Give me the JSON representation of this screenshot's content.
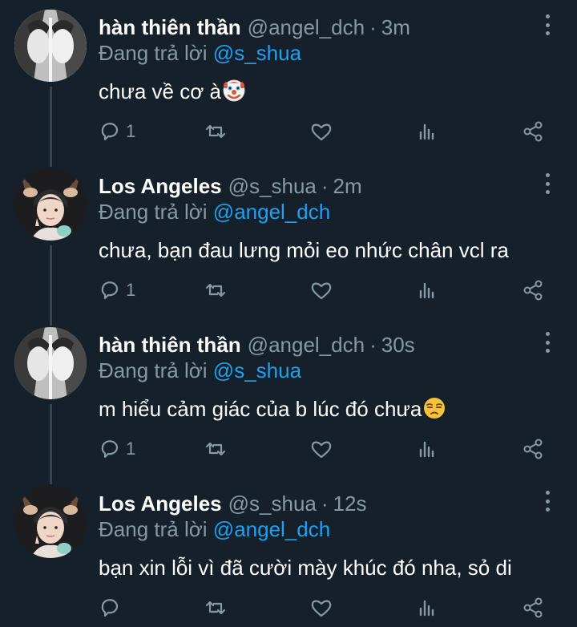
{
  "tweets": [
    {
      "display_name": "hàn thiên thần",
      "handle": "@angel_dch",
      "separator": "·",
      "time": "3m",
      "reply_prefix": "Đang trả lời",
      "reply_mention": "@s_shua",
      "text": "chưa về cơ à",
      "emoji": "clown-face",
      "reply_count": "1",
      "avatar": "bw-photo-avatar"
    },
    {
      "display_name": "Los Angeles",
      "handle": "@s_shua",
      "separator": "·",
      "time": "2m",
      "reply_prefix": "Đang trả lời",
      "reply_mention": "@angel_dch",
      "text": "chưa, bạn đau lưng mỏi eo nhức chân vcl ra",
      "emoji": "",
      "reply_count": "1",
      "avatar": "deer-ears-avatar"
    },
    {
      "display_name": "hàn thiên thần",
      "handle": "@angel_dch",
      "separator": "·",
      "time": "30s",
      "reply_prefix": "Đang trả lời",
      "reply_mention": "@s_shua",
      "text": "m hiểu cảm giác của b lúc đó chưa",
      "emoji": "unamused-face",
      "reply_count": "1",
      "avatar": "bw-photo-avatar"
    },
    {
      "display_name": "Los Angeles",
      "handle": "@s_shua",
      "separator": "·",
      "time": "12s",
      "reply_prefix": "Đang trả lời",
      "reply_mention": "@angel_dch",
      "text": "bạn xin lỗi vì đã cười mày khúc đó nha, sỏ di",
      "emoji": "",
      "reply_count": "",
      "avatar": "deer-ears-avatar"
    }
  ],
  "icons": {
    "reply": "reply-icon",
    "retweet": "retweet-icon",
    "like": "heart-icon",
    "stats": "stats-icon",
    "share": "share-icon",
    "more": "more-icon"
  },
  "colors": {
    "background": "#15202b",
    "secondary_text": "#8899a6",
    "mention": "#1da1f2",
    "thread_line": "#38444d"
  }
}
